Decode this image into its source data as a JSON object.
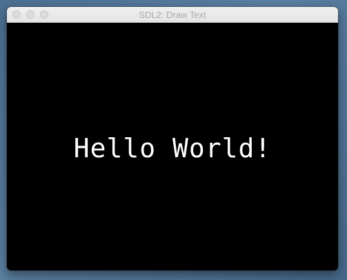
{
  "window": {
    "title": "SDL2: Draw Text"
  },
  "canvas": {
    "text": "Hello World!",
    "text_color": "#ffffff",
    "background_color": "#000000"
  },
  "icons": {
    "close": "close-button-icon",
    "minimize": "minimize-button-icon",
    "maximize": "maximize-button-icon"
  }
}
